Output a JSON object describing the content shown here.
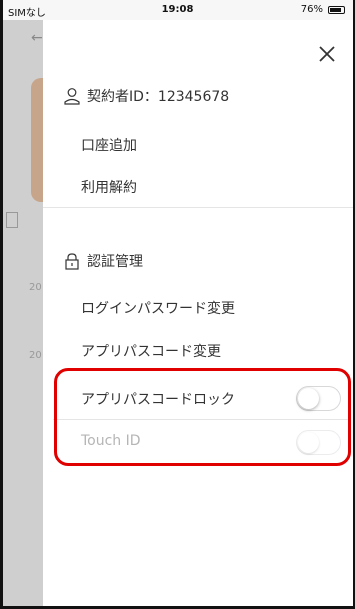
{
  "status_bar": {
    "carrier": "SIMなし",
    "time": "19:08",
    "battery": "76%"
  },
  "background": {
    "back_glyph": "←",
    "numbers": [
      "20",
      "20"
    ]
  },
  "drawer": {
    "close_icon": "close-icon",
    "contractor": {
      "icon": "user-icon",
      "label": "契約者ID：12345678"
    },
    "account_menu": [
      "口座追加",
      "利用解約"
    ],
    "auth": {
      "icon": "lock-icon",
      "title": "認証管理"
    },
    "auth_menu": [
      "ログインパスワード変更",
      "アプリパスコード変更"
    ],
    "toggles": [
      {
        "label": "アプリパスコードロック",
        "on": false,
        "enabled": true
      },
      {
        "label": "Touch ID",
        "on": false,
        "enabled": false
      }
    ]
  },
  "colors": {
    "highlight": "#e00000",
    "bg_overlay": "#cfcfcf",
    "card_accent": "#c7a58a"
  }
}
